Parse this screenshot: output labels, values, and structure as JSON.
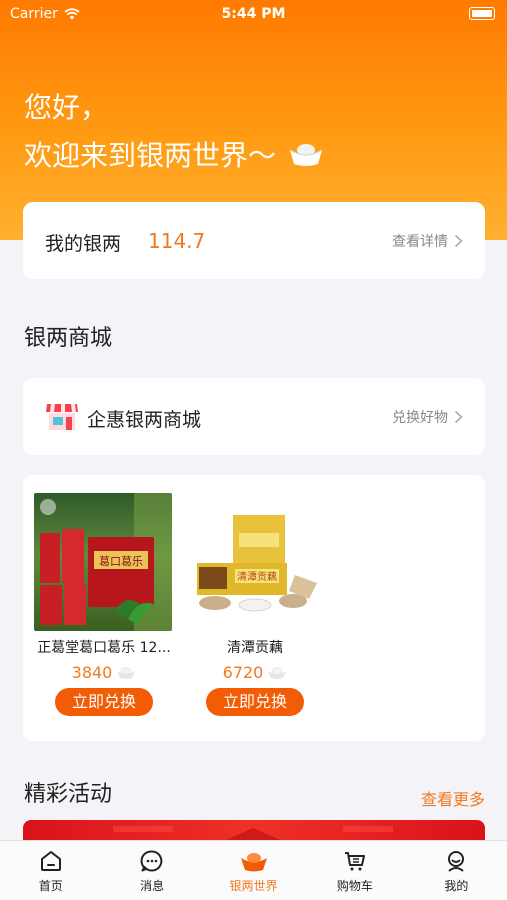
{
  "status_bar": {
    "carrier": "Carrier",
    "time": "5:44 PM"
  },
  "greeting": {
    "line1": "您好，",
    "line2": "欢迎来到银两世界～"
  },
  "silver_card": {
    "label": "我的银两",
    "value": "114.7",
    "detail_link": "查看详情"
  },
  "mall_section": {
    "title": "银两商城"
  },
  "mall_card": {
    "label": "企惠银两商城",
    "link": "兑换好物"
  },
  "products": [
    {
      "name": "正葛堂葛口葛乐 12...",
      "price": "3840",
      "button": "立即兑换",
      "image_text": "葛口葛乐"
    },
    {
      "name": "清潭贡藕",
      "price": "6720",
      "button": "立即兑换",
      "image_text": "清潭贡藕"
    }
  ],
  "activities": {
    "title": "精彩活动",
    "more_link": "查看更多"
  },
  "tabbar": {
    "items": [
      {
        "label": "首页",
        "icon": "home-icon"
      },
      {
        "label": "消息",
        "icon": "message-icon"
      },
      {
        "label": "银两世界",
        "icon": "silver-ingot-icon",
        "active": true
      },
      {
        "label": "购物车",
        "icon": "cart-icon"
      },
      {
        "label": "我的",
        "icon": "profile-icon"
      }
    ]
  },
  "colors": {
    "accent": "#f07a22",
    "button": "#f25c05",
    "hero_top": "#ff7a00",
    "hero_bottom": "#ffb030"
  }
}
